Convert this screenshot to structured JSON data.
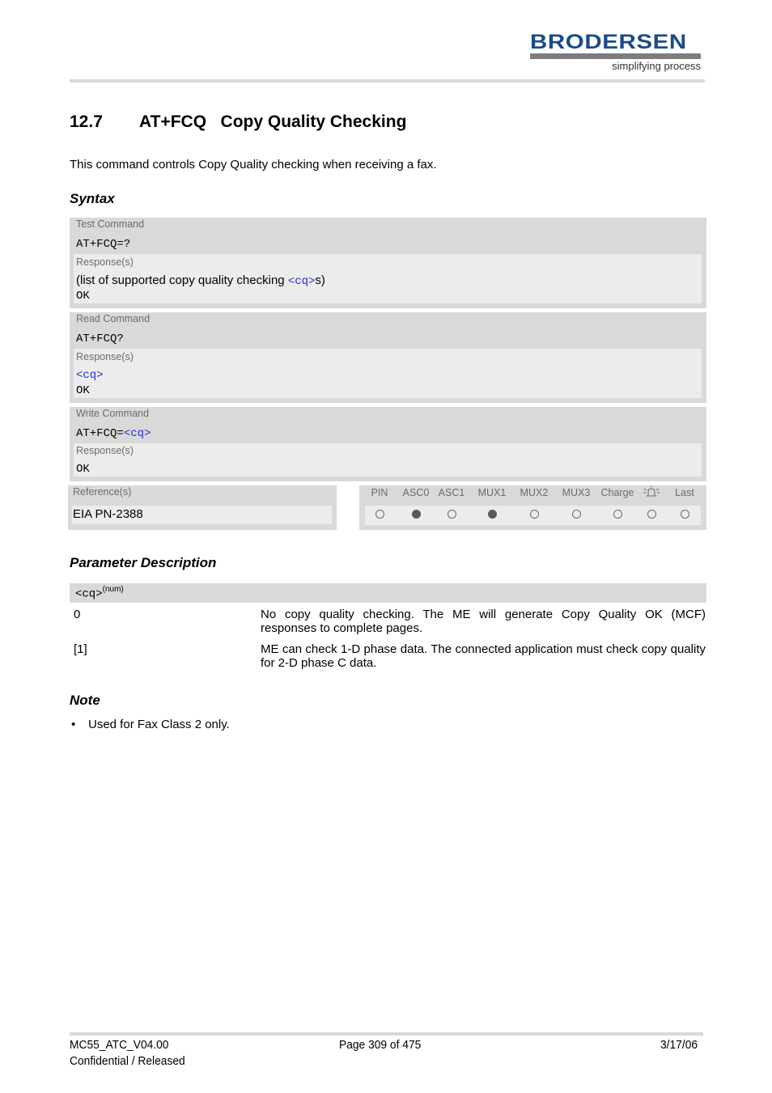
{
  "header": {
    "logo_name": "BRODERSEN",
    "logo_tagline": "simplifying process"
  },
  "section": {
    "number": "12.7",
    "title": "AT+FCQ   Copy Quality Checking",
    "intro": "This command controls Copy Quality checking when receiving a fax."
  },
  "syntax": {
    "heading": "Syntax",
    "test": {
      "label": "Test Command",
      "command": "AT+FCQ=?",
      "response_label": "Response(s)",
      "response_prefix": "(list of supported copy quality checking ",
      "response_param": "<cq>",
      "response_suffix": "s)",
      "response_ok": "OK"
    },
    "read": {
      "label": "Read Command",
      "command": "AT+FCQ?",
      "response_label": "Response(s)",
      "response_param": "<cq>",
      "response_ok": "OK"
    },
    "write": {
      "label": "Write Command",
      "command_prefix": "AT+FCQ=",
      "command_param": "<cq>",
      "response_label": "Response(s)",
      "response_ok": "OK"
    },
    "reference": {
      "label": "Reference(s)",
      "value": "EIA PN-2388"
    },
    "support_table": {
      "columns": [
        {
          "label": "PIN",
          "supported": false
        },
        {
          "label": "ASC0",
          "supported": true
        },
        {
          "label": "ASC1",
          "supported": false
        },
        {
          "label": "MUX1",
          "supported": true
        },
        {
          "label": "MUX2",
          "supported": false
        },
        {
          "label": "MUX3",
          "supported": false
        },
        {
          "label": "Charge",
          "supported": false
        },
        {
          "label": "",
          "icon": "alarm-icon",
          "supported": false
        },
        {
          "label": "Last",
          "supported": false
        }
      ]
    }
  },
  "parameters": {
    "heading": "Parameter Description",
    "param_name": "<cq>",
    "param_type": "(num)",
    "values": [
      {
        "value": "0",
        "description": "No copy quality checking. The ME will generate Copy Quality OK (MCF) responses to complete pages."
      },
      {
        "value": "[1]",
        "description": "ME can check 1-D phase data. The connected application must check copy quality for 2-D phase C data."
      }
    ]
  },
  "note": {
    "heading": "Note",
    "items": [
      "Used for Fax Class 2 only."
    ]
  },
  "footer": {
    "doc_id": "MC55_ATC_V04.00",
    "status": "Confidential / Released",
    "page": "Page 309 of 475",
    "date": "3/17/06"
  }
}
